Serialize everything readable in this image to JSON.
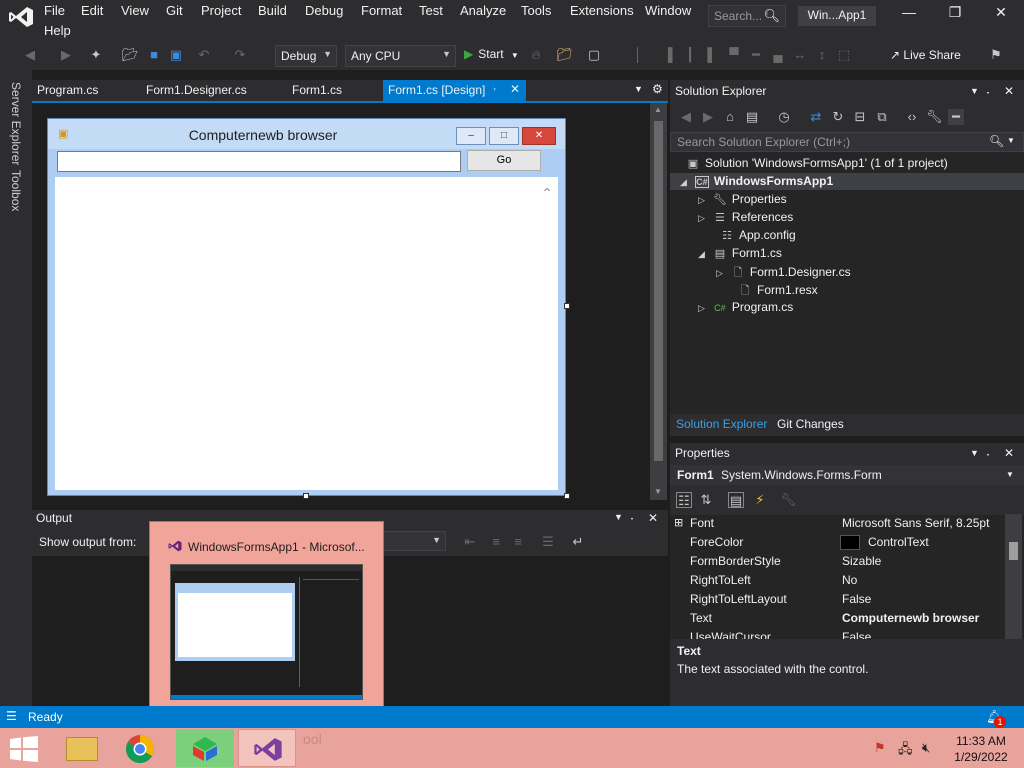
{
  "menu": [
    "File",
    "Edit",
    "View",
    "Git",
    "Project",
    "Build",
    "Debug",
    "Format",
    "Test",
    "Analyze",
    "Tools",
    "Extensions",
    "Window",
    "Help"
  ],
  "search_label": "Search...",
  "window_title": "Win...App1",
  "toolbar": {
    "config": "Debug",
    "platform": "Any CPU",
    "start_label": "Start",
    "live_share": "Live Share"
  },
  "left_rail": {
    "server_explorer": "Server Explorer",
    "toolbox": "Toolbox"
  },
  "tabs": [
    {
      "label": "Program.cs",
      "active": false
    },
    {
      "label": "Form1.Designer.cs",
      "active": false
    },
    {
      "label": "Form1.cs",
      "active": false
    },
    {
      "label": "Form1.cs [Design]",
      "active": true
    }
  ],
  "form": {
    "title": "Computernewb browser",
    "go_button": "Go"
  },
  "output": {
    "title": "Output",
    "show_output_from": "Show output from:"
  },
  "popup": {
    "title": "WindowsFormsApp1 - Microsof..."
  },
  "solution_explorer": {
    "title": "Solution Explorer",
    "search_placeholder": "Search Solution Explorer (Ctrl+;)",
    "items": [
      {
        "label": "Solution 'WindowsFormsApp1' (1 of 1 project)",
        "icon": "solution-icon"
      },
      {
        "label": "WindowsFormsApp1",
        "icon": "csharp-project-icon"
      },
      {
        "label": "Properties",
        "icon": "wrench-icon"
      },
      {
        "label": "References",
        "icon": "references-icon"
      },
      {
        "label": "App.config",
        "icon": "config-file-icon"
      },
      {
        "label": "Form1.cs",
        "icon": "form-icon"
      },
      {
        "label": "Form1.Designer.cs",
        "icon": "file-icon"
      },
      {
        "label": "Form1.resx",
        "icon": "file-icon"
      },
      {
        "label": "Program.cs",
        "icon": "csharp-file-icon"
      }
    ],
    "bottom_tabs": [
      "Solution Explorer",
      "Git Changes"
    ]
  },
  "properties": {
    "title": "Properties",
    "object_name": "Form1",
    "object_type": "System.Windows.Forms.Form",
    "rows": [
      {
        "name": "Font",
        "value": "Microsoft Sans Serif, 8.25pt",
        "expandable": true
      },
      {
        "name": "ForeColor",
        "value": "ControlText",
        "swatch": "#000000"
      },
      {
        "name": "FormBorderStyle",
        "value": "Sizable"
      },
      {
        "name": "RightToLeft",
        "value": "No"
      },
      {
        "name": "RightToLeftLayout",
        "value": "False"
      },
      {
        "name": "Text",
        "value": "Computernewb browser",
        "bold": true
      },
      {
        "name": "UseWaitCursor",
        "value": "False"
      }
    ],
    "desc_title": "Text",
    "desc_text": "The text associated with the control."
  },
  "status": {
    "text": "Ready",
    "notifications": "1"
  },
  "taskbar": {
    "ghost_text": "ool",
    "time": "11:33 AM",
    "date": "1/29/2022"
  },
  "colors": {
    "accent": "#007acc",
    "taskbar": "#e8a49c"
  }
}
